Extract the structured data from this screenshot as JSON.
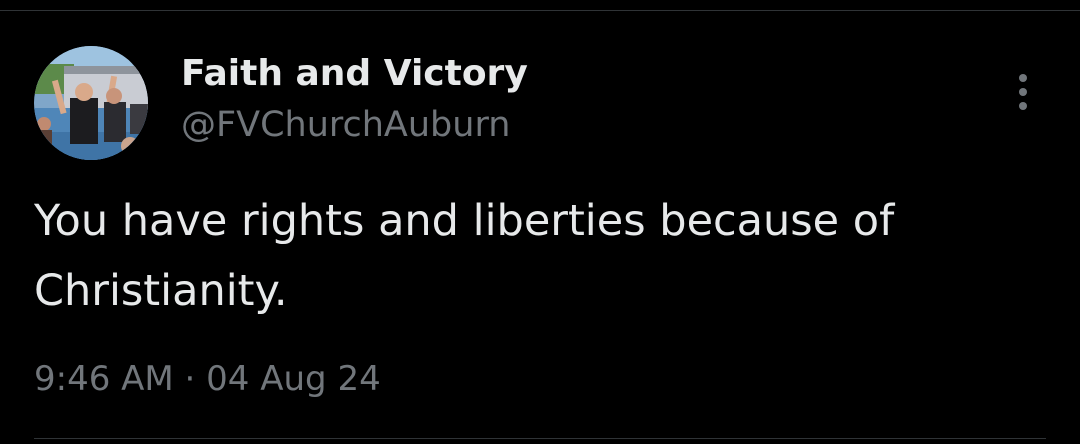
{
  "tweet": {
    "display_name": "Faith and Victory",
    "handle": "@FVChurchAuburn",
    "text": "You have rights and liberties because of\nChristianity.",
    "timestamp": "9:46 AM · 04 Aug 24",
    "more_icon": "more-vertical-icon",
    "avatar": "profile-photo-avatar"
  },
  "colors": {
    "background": "#000000",
    "primary_text": "#e7e9ea",
    "secondary_text": "#71767b",
    "divider": "#2f3336"
  }
}
